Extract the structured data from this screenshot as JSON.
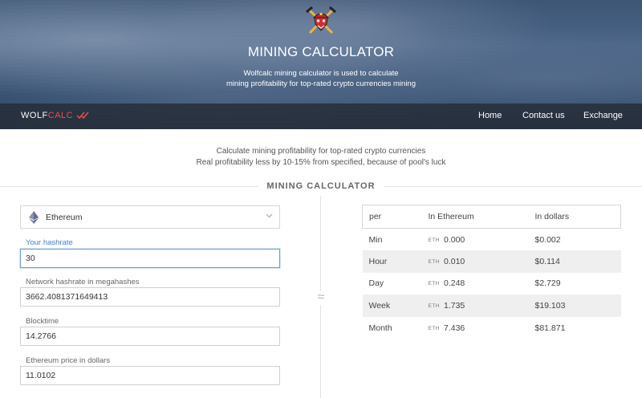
{
  "hero": {
    "title": "MINING CALCULATOR",
    "subtitle_line1": "Wolfcalc mining calculator is used to calculate",
    "subtitle_line2": "mining profitability for top-rated crypto currencies mining"
  },
  "navbar": {
    "brand_part1": "WOLF",
    "brand_part2": "CALC",
    "links": [
      "Home",
      "Contact us",
      "Exchange"
    ]
  },
  "intro": {
    "line1": "Calculate mining profitability for top-rated crypto currencies",
    "line2": "Real profitability less by 10-15% from specified, because of pool's luck"
  },
  "section_title": "MINING CALCULATOR",
  "approx_symbol": "≈",
  "form": {
    "coin": "Ethereum",
    "fields": [
      {
        "label": "Your hashrate",
        "value": "30"
      },
      {
        "label": "Network hashrate in megahashes",
        "value": "3662.4081371649413"
      },
      {
        "label": "Blocktime",
        "value": "14.2766"
      },
      {
        "label": "Ethereum price in dollars",
        "value": "11.0102"
      }
    ]
  },
  "results": {
    "headers": [
      "per",
      "In Ethereum",
      "In dollars"
    ],
    "unit": "ETH",
    "rows": [
      {
        "period": "Min",
        "eth": "0.000",
        "usd": "$0.002"
      },
      {
        "period": "Hour",
        "eth": "0.010",
        "usd": "$0.114"
      },
      {
        "period": "Day",
        "eth": "0.248",
        "usd": "$2.729"
      },
      {
        "period": "Week",
        "eth": "1.735",
        "usd": "$19.103"
      },
      {
        "period": "Month",
        "eth": "7.436",
        "usd": "$81.871"
      }
    ]
  },
  "colors": {
    "accent_red": "#e8514a",
    "focus_blue": "#3b7fd1",
    "navbar": "#262c36"
  }
}
